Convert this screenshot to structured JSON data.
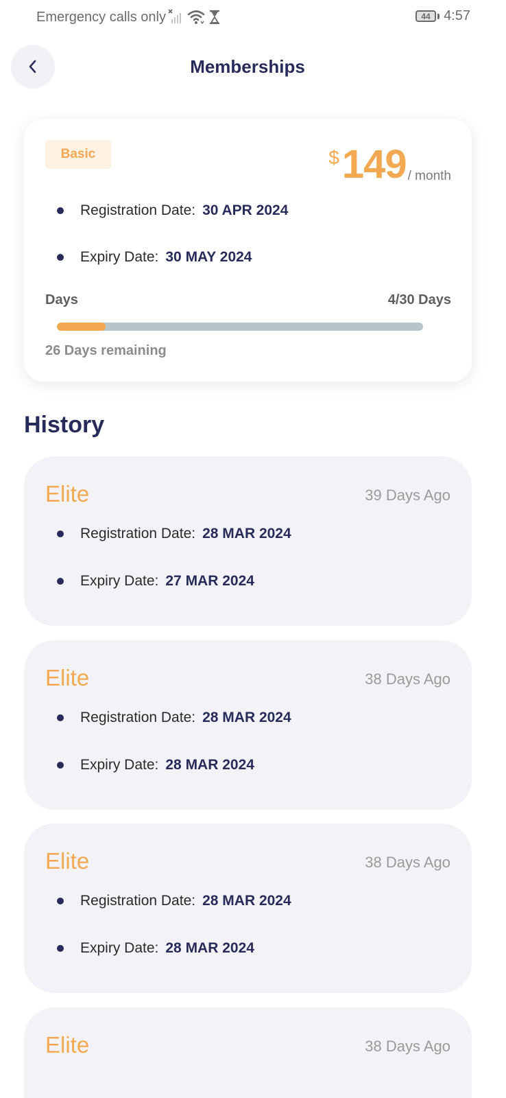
{
  "status_bar": {
    "carrier_text": "Emergency calls only",
    "battery_level": "44",
    "time": "4:57",
    "icons": [
      "no-signal-icon",
      "wifi-icon",
      "hourglass-icon",
      "battery-icon"
    ]
  },
  "header": {
    "back_icon": "chevron-left-icon",
    "title": "Memberships"
  },
  "current": {
    "plan": "Basic",
    "currency": "$",
    "price": "149",
    "price_unit": "/ month",
    "registration_label": "Registration Date:",
    "registration_value": "30 APR 2024",
    "expiry_label": "Expiry Date:",
    "expiry_value": "30 MAY 2024",
    "days_label": "Days",
    "days_count": "4/30 Days",
    "progress_fraction": 0.1333,
    "remaining": "26 Days remaining"
  },
  "history": {
    "title": "History",
    "items": [
      {
        "plan": "Elite",
        "ago": "39 Days Ago",
        "registration_label": "Registration Date:",
        "registration_value": "28 MAR 2024",
        "expiry_label": "Expiry Date:",
        "expiry_value": "27 MAR 2024"
      },
      {
        "plan": "Elite",
        "ago": "38 Days Ago",
        "registration_label": "Registration Date:",
        "registration_value": "28 MAR 2024",
        "expiry_label": "Expiry Date:",
        "expiry_value": "28 MAR 2024"
      },
      {
        "plan": "Elite",
        "ago": "38 Days Ago",
        "registration_label": "Registration Date:",
        "registration_value": "28 MAR 2024",
        "expiry_label": "Expiry Date:",
        "expiry_value": "28 MAR 2024"
      },
      {
        "plan": "Elite",
        "ago": "38 Days Ago"
      }
    ]
  },
  "colors": {
    "accent": "#f3a952",
    "navy": "#272b59",
    "card_bg": "#f3f3f7",
    "progress_track": "#b8c4cb"
  }
}
